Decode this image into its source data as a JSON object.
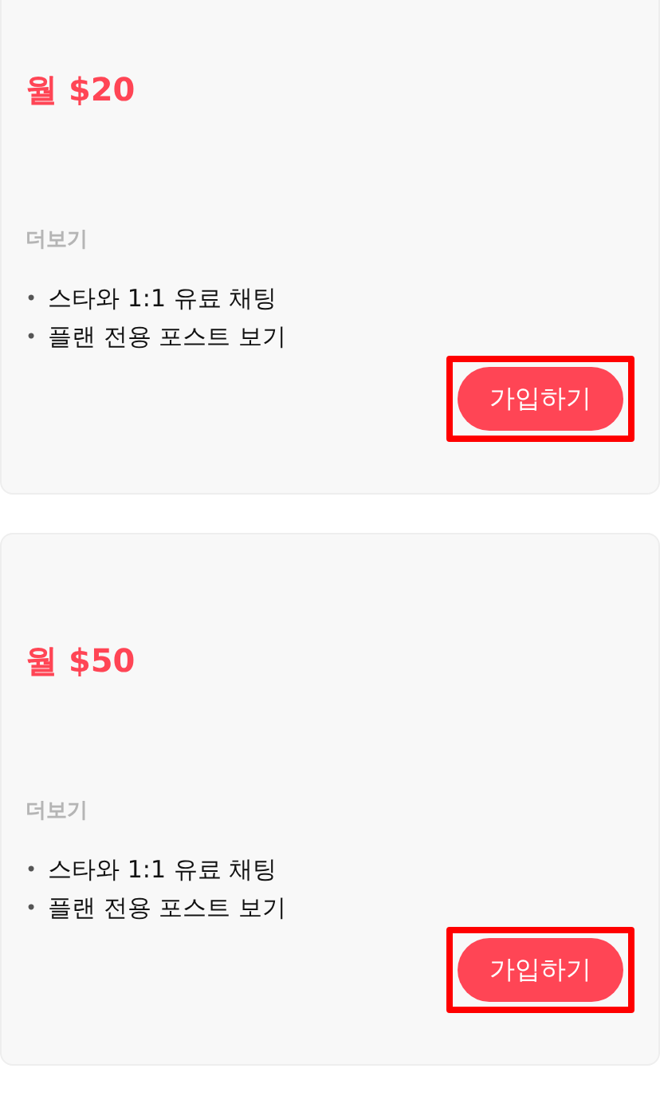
{
  "plans": [
    {
      "price": "월 $20",
      "more_label": "더보기",
      "features": [
        {
          "bullet": "•",
          "text": "스타와 1:1 유료 채팅"
        },
        {
          "bullet": "•",
          "text": "플랜 전용 포스트 보기"
        }
      ],
      "button": "가입하기",
      "highlighted": true
    },
    {
      "price": "월 $50",
      "more_label": "더보기",
      "features": [
        {
          "bullet": "•",
          "text": "스타와 1:1 유료 채팅"
        },
        {
          "bullet": "•",
          "text": "플랜 전용 포스트 보기"
        }
      ],
      "button": "가입하기",
      "highlighted": true
    }
  ]
}
